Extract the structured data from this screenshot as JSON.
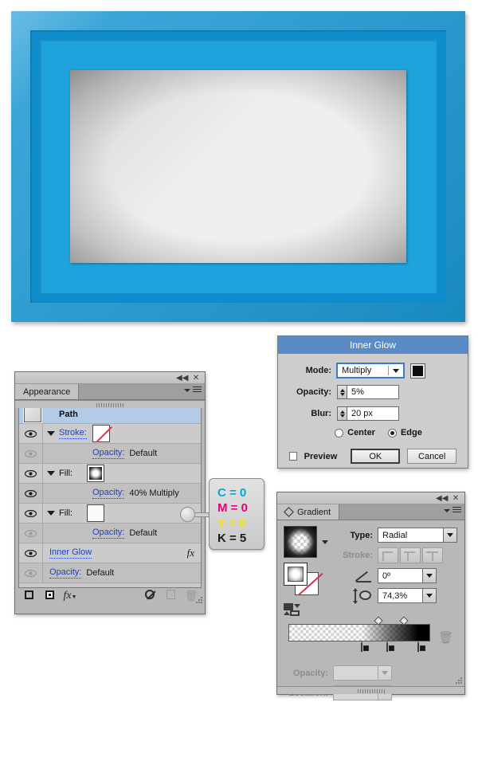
{
  "artwork": {
    "name": "blue-picture-frame-illustration",
    "frame_outer_color": "#1c9ad6",
    "frame_mid_color": "#0e8ccb",
    "frame_inner_band_color": "#1fa3dd",
    "canvas_color": "#efefef"
  },
  "appearance_panel": {
    "tab_label": "Appearance",
    "collapse_icon": "◀◀",
    "close_icon": "✕",
    "rows": [
      {
        "kind": "header",
        "label": "Path",
        "eye": null,
        "disclosure": false,
        "swatch": "path-thumb"
      },
      {
        "kind": "item",
        "label": "Stroke:",
        "label_link": true,
        "eye": "on",
        "disclosure": true,
        "swatch": "none",
        "value": ""
      },
      {
        "kind": "sub",
        "label": "Opacity:",
        "label_link": true,
        "eye": "off",
        "disclosure": false,
        "value": "Default"
      },
      {
        "kind": "item",
        "label": "Fill:",
        "label_link": false,
        "eye": "on",
        "disclosure": true,
        "swatch": "gradient",
        "value": ""
      },
      {
        "kind": "sub",
        "label": "Opacity:",
        "label_link": true,
        "eye": "on",
        "disclosure": false,
        "value": "40% Multiply"
      },
      {
        "kind": "item",
        "label": "Fill:",
        "label_link": false,
        "eye": "on",
        "disclosure": true,
        "swatch": "white",
        "value": ""
      },
      {
        "kind": "sub",
        "label": "Opacity:",
        "label_link": true,
        "eye": "off",
        "disclosure": false,
        "value": "Default"
      },
      {
        "kind": "effect",
        "label": "Inner Glow",
        "label_link": true,
        "eye": "on",
        "disclosure": false,
        "badge": "fx"
      },
      {
        "kind": "sub",
        "label": "Opacity:",
        "label_link": true,
        "eye": "off",
        "disclosure": false,
        "value": "Default"
      }
    ],
    "footer_buttons": [
      {
        "name": "add-new-stroke",
        "icon": "square-outline-icon"
      },
      {
        "name": "add-new-fill",
        "icon": "square-filled-icon"
      },
      {
        "name": "add-new-effect",
        "icon": "fx-icon",
        "label": "fx"
      },
      {
        "name": "clear-appearance",
        "icon": "circle-slash-icon"
      },
      {
        "name": "duplicate-item",
        "icon": "duplicate-page-icon"
      },
      {
        "name": "delete-item",
        "icon": "trash-icon"
      }
    ]
  },
  "cmyk_callout": {
    "c": "C = 0",
    "m": "M = 0",
    "y": "Y = 0",
    "k": "K = 5",
    "c_color": "#00a8e0",
    "m_color": "#e5007d",
    "y_color": "#f2e500",
    "k_color": "#1a1a1a"
  },
  "inner_glow_dialog": {
    "title": "Inner Glow",
    "mode_label": "Mode:",
    "mode_value": "Multiply",
    "mode_color_swatch": "#0d0d0d",
    "opacity_label": "Opacity:",
    "opacity_value": "5%",
    "blur_label": "Blur:",
    "blur_value": "20 px",
    "radio_center": "Center",
    "radio_edge": "Edge",
    "radio_selected": "Edge",
    "preview_label": "Preview",
    "preview_checked": false,
    "ok_label": "OK",
    "cancel_label": "Cancel",
    "title_bar_color": "#5b8bc4"
  },
  "gradient_panel": {
    "tab_label": "Gradient",
    "collapse_icon": "◀◀",
    "close_icon": "✕",
    "type_label": "Type:",
    "type_value": "Radial",
    "stroke_label": "Stroke:",
    "stroke_options": [
      "stroke-within-icon",
      "stroke-centered-icon",
      "stroke-outside-icon"
    ],
    "angle_label": "angle-icon",
    "angle_value": "0º",
    "aspect_label": "aspect-ratio-icon",
    "aspect_value": "74,3%",
    "opacity_label": "Opacity:",
    "opacity_value": "",
    "location_label": "Location:",
    "location_value": "",
    "stops": [
      {
        "position_pct": 54,
        "color": "#ffffff"
      },
      {
        "position_pct": 72,
        "color": "#3a3a3a"
      },
      {
        "position_pct": 94,
        "color": "#000000"
      }
    ],
    "midpoints_pct": [
      63,
      80
    ],
    "delete_stop_icon": "trash-icon"
  }
}
